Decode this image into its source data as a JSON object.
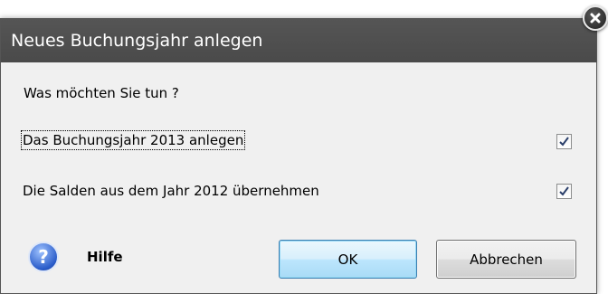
{
  "dialog": {
    "title": "Neues Buchungsjahr anlegen",
    "question": "Was möchten Sie tun ?",
    "options": [
      {
        "label": "Das Buchungsjahr 2013 anlegen",
        "checked": true
      },
      {
        "label": "Die Salden aus dem Jahr 2012 übernehmen",
        "checked": true
      }
    ],
    "help_label": "Hilfe",
    "help_icon": "?",
    "ok_label": "OK",
    "cancel_label": "Abbrechen"
  },
  "icons": {
    "close": "close-icon",
    "help": "help-icon",
    "check": "check-icon"
  },
  "colors": {
    "titlebar": "#4f4f4f",
    "dialog_bg": "#f0f0f0",
    "ok_border": "#3c7fb1",
    "help_icon": "#2a5cc9"
  }
}
